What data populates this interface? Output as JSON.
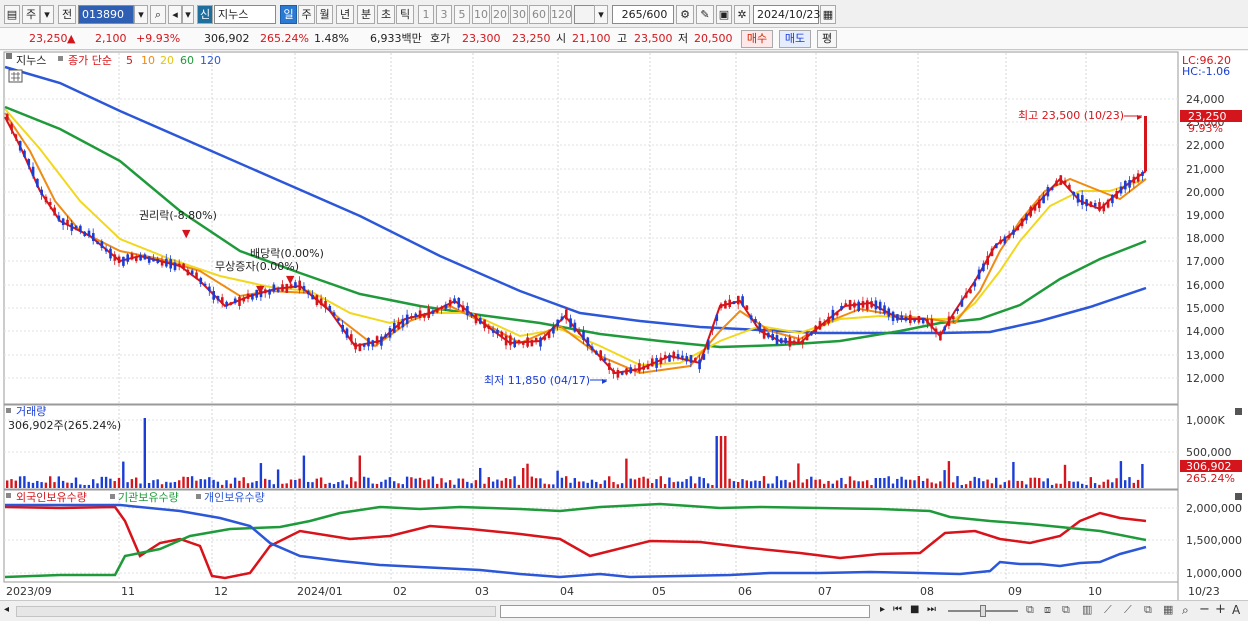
{
  "toolbar": {
    "market": "주",
    "type": "전",
    "code": "013890",
    "badge": "신",
    "name": "지누스",
    "periods": [
      "일",
      "주",
      "월",
      "년",
      "분",
      "초",
      "틱"
    ],
    "counts": [
      "1",
      "3",
      "5",
      "10",
      "20",
      "30",
      "60",
      "120"
    ],
    "range": "265",
    "range_total": "/600",
    "date": "2024/10/23"
  },
  "info": {
    "price": "23,250",
    "change": "2,100",
    "change_pct": "+9.93%",
    "volume": "306,902",
    "vol_ratio": "265.24%",
    "turnover": "1.48%",
    "amount": "6,933백만",
    "ask_label": "호가",
    "ask1": "23,300",
    "ask2": "23,250",
    "open_label": "시",
    "open": "21,100",
    "high_label": "고",
    "high": "23,500",
    "low_label": "저",
    "low": "20,500",
    "buy": "매수",
    "sell": "매도",
    "eval": "평"
  },
  "price_panel": {
    "name_tag": "지누스",
    "legend_prefix": "종가 단순",
    "ma": [
      {
        "label": "5",
        "color": "#d8131a"
      },
      {
        "label": "10",
        "color": "#f08a12"
      },
      {
        "label": "20",
        "color": "#f2d81c"
      },
      {
        "label": "60",
        "color": "#1f9a3a"
      },
      {
        "label": "120",
        "color": "#2b57d8"
      }
    ],
    "lc": "LC:96.20",
    "hc": "HC:-1.06",
    "y_ticks": [
      "24,000",
      "23,000",
      "22,000",
      "21,000",
      "20,000",
      "19,000",
      "18,000",
      "17,000",
      "16,000",
      "15,000",
      "14,000",
      "13,000",
      "12,000"
    ],
    "current_tag": "23,250",
    "current_pct": "9.93%",
    "annotations": {
      "high": "최고 23,500 (10/23)",
      "low": "최저 11,850 (04/17)",
      "rights": "권리락(-8.80%)",
      "bonus": "무상증자(0.00%)",
      "dividend": "배당락(0.00%)"
    }
  },
  "volume_panel": {
    "title": "거래량",
    "value": "306,902주(265.24%)",
    "y_ticks": [
      "1,000K",
      "500,000"
    ],
    "current_tag": "306,902",
    "current_pct": "265.24%"
  },
  "holdings_panel": {
    "legend": [
      "외국인보유수량",
      "기관보유수량",
      "개인보유수량"
    ],
    "y_ticks": [
      "2,000,000",
      "1,500,000",
      "1,000,000"
    ]
  },
  "x_axis": {
    "labels": [
      "2023/09",
      "11",
      "12",
      "2024/01",
      "02",
      "03",
      "04",
      "05",
      "06",
      "07",
      "08",
      "09",
      "10"
    ],
    "end_label": "10/23"
  },
  "colors": {
    "up": "#d4161c",
    "down": "#1a3dd6",
    "ma5": "#d8131a",
    "ma10": "#f08a12",
    "ma20": "#f2d81c",
    "ma60": "#1f9a3a",
    "ma120": "#2b57d8"
  }
}
